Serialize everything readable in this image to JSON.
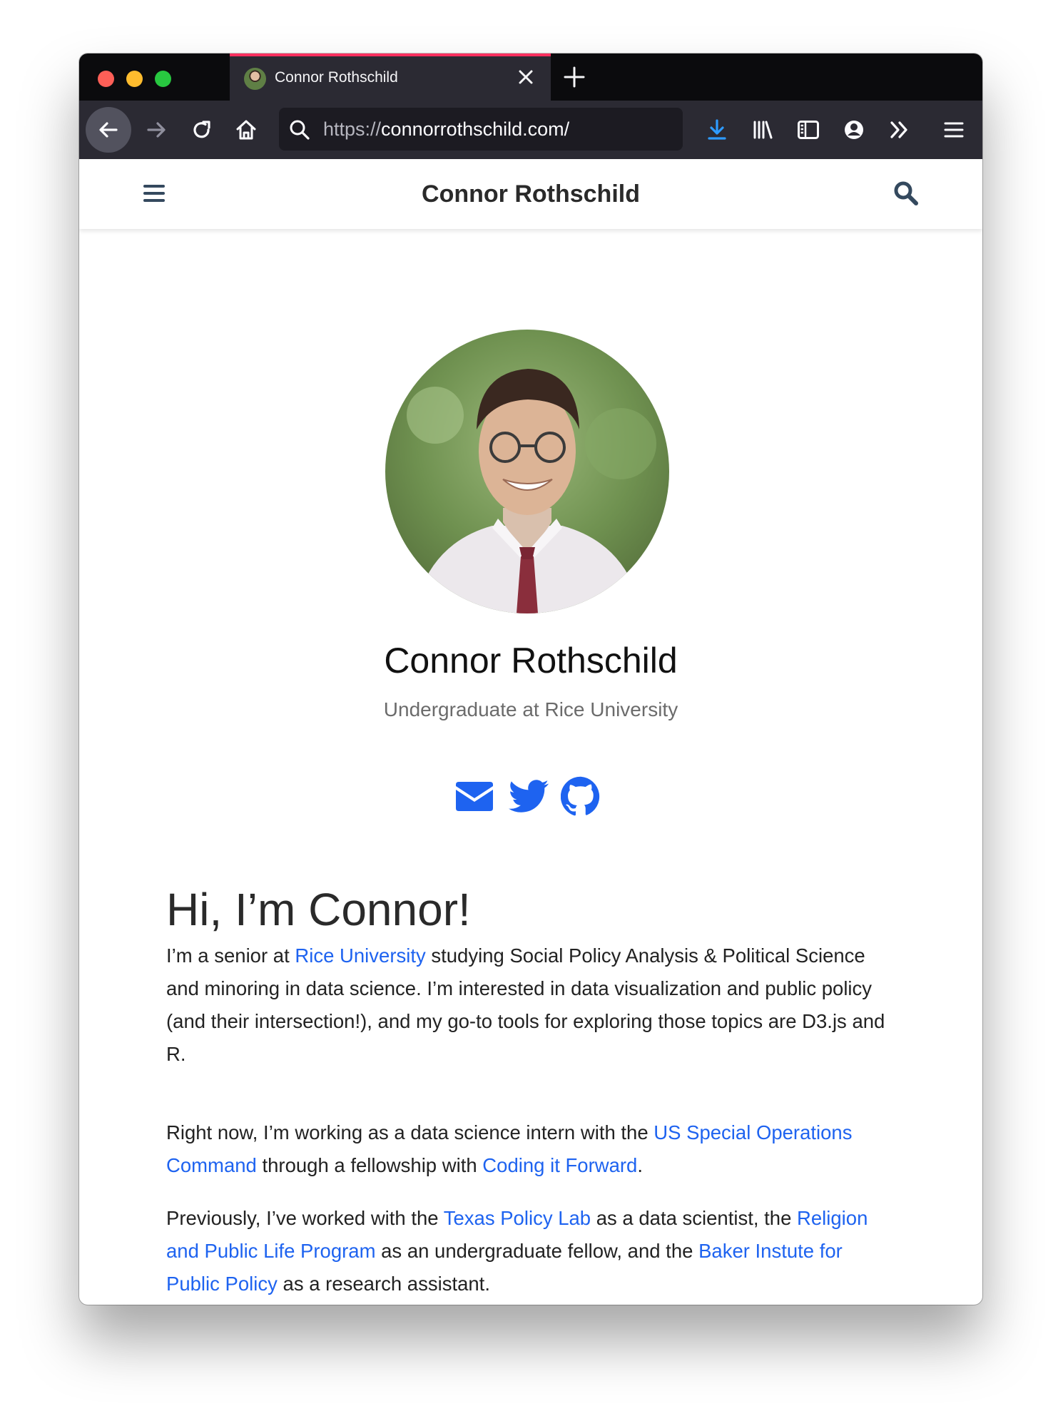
{
  "browser": {
    "tab": {
      "title": "Connor Rothschild"
    },
    "url": {
      "scheme": "https://",
      "host": "connorrothschild.com/"
    }
  },
  "site": {
    "title": "Connor Rothschild"
  },
  "profile": {
    "name": "Connor Rothschild",
    "subtitle": "Undergraduate at Rice University",
    "social_icons": [
      "envelope-icon",
      "twitter-icon",
      "github-icon"
    ],
    "accent_color": "#1e63f0"
  },
  "intro": {
    "heading": "Hi, I’m Connor!",
    "p1": {
      "t1": "I’m a senior at ",
      "link1": "Rice University",
      "t2": " studying Social Policy Analysis & Political Science and minoring in data science. I’m interested in data visualization and public policy (and their intersection!), and my go-to tools for exploring those topics are D3.js and R."
    },
    "p2": {
      "t1": "Right now, I’m working as a data science intern with the ",
      "link1": "US Special Operations Command",
      "t2": " through a fellowship with ",
      "link2": "Coding it Forward",
      "t3": "."
    },
    "p3": {
      "t1": "Previously, I’ve worked with the ",
      "link1": "Texas Policy Lab",
      "t2": " as a data scientist, the ",
      "link2": "Religion and Public Life Program",
      "t3": " as an undergraduate fellow, and the ",
      "link3": "Baker Instute for Public Policy",
      "t4": " as a research assistant."
    }
  }
}
